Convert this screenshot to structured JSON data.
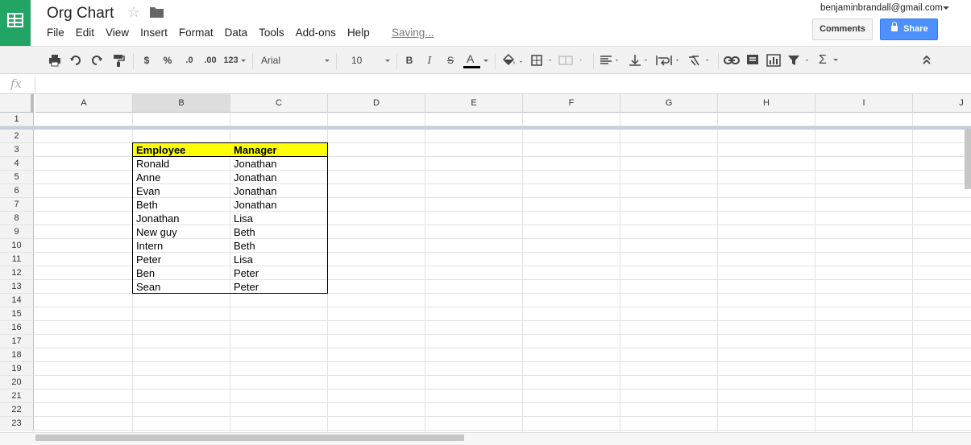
{
  "document": {
    "title": "Org Chart",
    "saving_status": "Saving..."
  },
  "menu": [
    "File",
    "Edit",
    "View",
    "Insert",
    "Format",
    "Data",
    "Tools",
    "Add-ons",
    "Help"
  ],
  "account": {
    "email": "benjaminbrandall@gmail.com"
  },
  "buttons": {
    "comments": "Comments",
    "share": "Share"
  },
  "toolbar": {
    "currency": "$",
    "percent": "%",
    "decrease_decimals": ".0",
    "increase_decimals": ".00",
    "more_formats": "123",
    "font": "Arial",
    "font_size": "10",
    "bold": "B",
    "italic": "I",
    "strikethrough": "S",
    "text_color": "A",
    "sum": "Σ",
    "text_color_value": "#000000"
  },
  "formula_bar": {
    "icon": "fx",
    "value": ""
  },
  "columns": [
    "A",
    "B",
    "C",
    "D",
    "E",
    "F",
    "G",
    "H",
    "I",
    "J"
  ],
  "selected_column": "B",
  "rows": [
    "1",
    "2",
    "3",
    "4",
    "5",
    "6",
    "7",
    "8",
    "9",
    "10",
    "11",
    "12",
    "13",
    "14",
    "15",
    "16",
    "17",
    "18",
    "19",
    "20",
    "21",
    "22",
    "23"
  ],
  "table": {
    "header": [
      "Employee",
      "Manager"
    ],
    "rows": [
      [
        "Ronald",
        "Jonathan"
      ],
      [
        "Anne",
        "Jonathan"
      ],
      [
        "Evan",
        "Jonathan"
      ],
      [
        "Beth",
        "Jonathan"
      ],
      [
        "Jonathan",
        "Lisa"
      ],
      [
        "New guy",
        "Beth"
      ],
      [
        "Intern",
        "Beth"
      ],
      [
        "Peter",
        "Lisa"
      ],
      [
        "Ben",
        "Peter"
      ],
      [
        "Sean",
        "Peter"
      ]
    ]
  },
  "colors": {
    "brand": "#21a464",
    "share": "#4d90fe",
    "header_highlight": "#ffff00"
  }
}
